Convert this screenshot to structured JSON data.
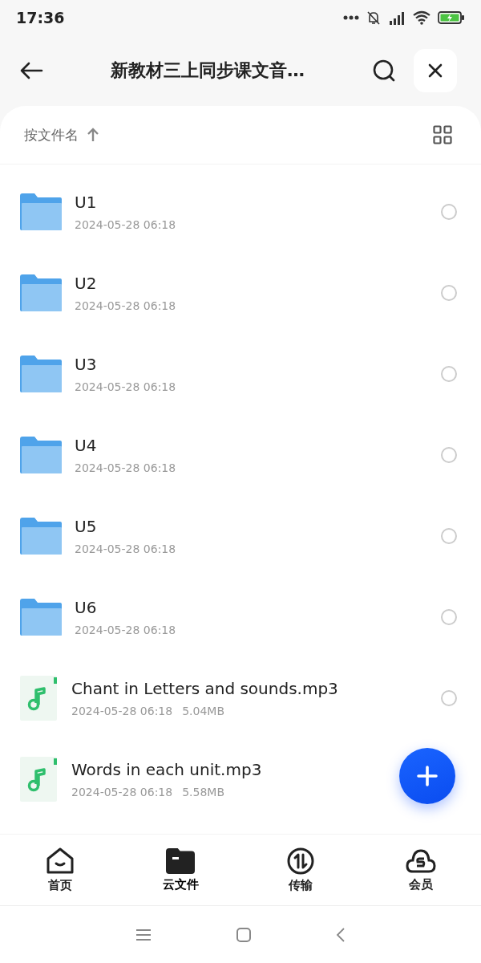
{
  "status_bar": {
    "time": "17:36"
  },
  "header": {
    "title": "新教材三上同步课文音…"
  },
  "sort": {
    "label": "按文件名"
  },
  "files": [
    {
      "kind": "folder",
      "name": "U1",
      "meta": "2024-05-28 06:18",
      "selected": false
    },
    {
      "kind": "folder",
      "name": "U2",
      "meta": "2024-05-28 06:18",
      "selected": false
    },
    {
      "kind": "folder",
      "name": "U3",
      "meta": "2024-05-28 06:18",
      "selected": false
    },
    {
      "kind": "folder",
      "name": "U4",
      "meta": "2024-05-28 06:18",
      "selected": false
    },
    {
      "kind": "folder",
      "name": "U5",
      "meta": "2024-05-28 06:18",
      "selected": false
    },
    {
      "kind": "folder",
      "name": "U6",
      "meta": "2024-05-28 06:18",
      "selected": false
    },
    {
      "kind": "audio",
      "name": "Chant in Letters and sounds.mp3",
      "meta": "2024-05-28 06:18",
      "size": "5.04MB",
      "selected": false
    },
    {
      "kind": "audio",
      "name": "Words in each unit.mp3",
      "meta": "2024-05-28 06:18",
      "size": "5.58MB"
    }
  ],
  "tabs": [
    {
      "kind": "home",
      "label": "首页",
      "selected": false
    },
    {
      "kind": "cloud_files",
      "label": "云文件",
      "selected": true
    },
    {
      "kind": "transfer",
      "label": "传输",
      "selected": false
    },
    {
      "kind": "member",
      "label": "会员",
      "selected": false
    }
  ]
}
